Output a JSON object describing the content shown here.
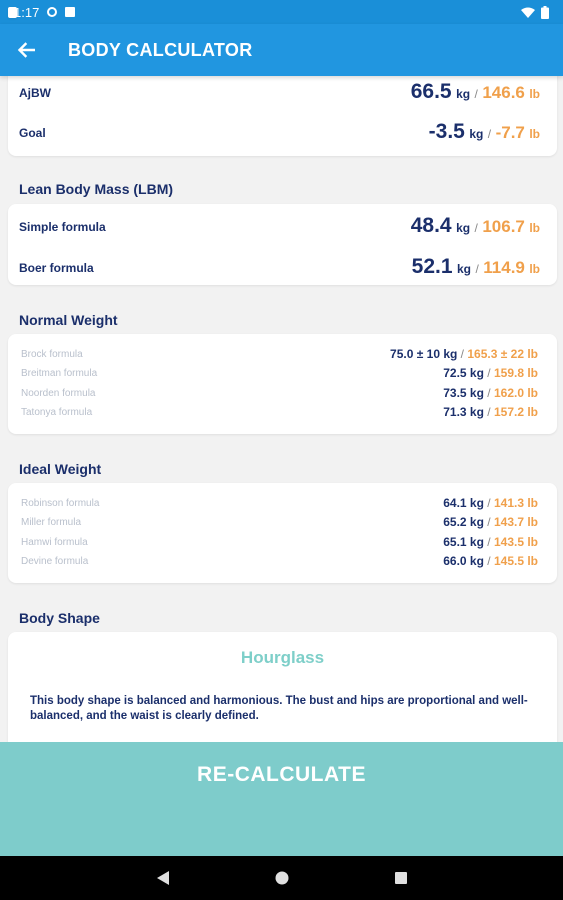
{
  "status": {
    "time": "1:17"
  },
  "app_bar": {
    "title": "BODY CALCULATOR"
  },
  "summary": {
    "rows": [
      {
        "label": "AjBW",
        "kg": "66.5",
        "kg_unit": "kg",
        "sep": "/",
        "lb": "146.6",
        "lb_unit": "lb"
      },
      {
        "label": "Goal",
        "kg": "-3.5",
        "kg_unit": "kg",
        "sep": "/",
        "lb": "-7.7",
        "lb_unit": "lb"
      }
    ]
  },
  "lbm": {
    "title": "Lean Body Mass (LBM)",
    "rows": [
      {
        "label": "Simple formula",
        "kg": "48.4",
        "kg_unit": "kg",
        "sep": "/",
        "lb": "106.7",
        "lb_unit": "lb"
      },
      {
        "label": "Boer formula",
        "kg": "52.1",
        "kg_unit": "kg",
        "sep": "/",
        "lb": "114.9",
        "lb_unit": "lb"
      }
    ]
  },
  "normal_weight": {
    "title": "Normal Weight",
    "rows": [
      {
        "label": "Brock formula",
        "kg": "75.0 ± 10 kg",
        "sep": "/",
        "lb": "165.3 ± 22 lb"
      },
      {
        "label": "Breitman formula",
        "kg": "72.5 kg",
        "sep": "/",
        "lb": "159.8 lb"
      },
      {
        "label": "Noorden formula",
        "kg": "73.5 kg",
        "sep": "/",
        "lb": "162.0 lb"
      },
      {
        "label": "Tatonya formula",
        "kg": "71.3 kg",
        "sep": "/",
        "lb": "157.2 lb"
      }
    ]
  },
  "ideal_weight": {
    "title": "Ideal Weight",
    "rows": [
      {
        "label": "Robinson formula",
        "kg": "64.1 kg",
        "sep": "/",
        "lb": "141.3 lb"
      },
      {
        "label": "Miller formula",
        "kg": "65.2 kg",
        "sep": "/",
        "lb": "143.7 lb"
      },
      {
        "label": "Hamwi formula",
        "kg": "65.1 kg",
        "sep": "/",
        "lb": "143.5 lb"
      },
      {
        "label": "Devine formula",
        "kg": "66.0 kg",
        "sep": "/",
        "lb": "145.5 lb"
      }
    ]
  },
  "body_shape": {
    "title": "Body Shape",
    "name": "Hourglass",
    "description": "This body shape is balanced and harmonious. The bust and hips are proportional and well-balanced, and the waist is clearly defined."
  },
  "recalculate": {
    "label": "RE-CALCULATE"
  },
  "icons": {
    "status": [
      "gear-icon",
      "notification-icon",
      "sd-card-icon",
      "wifi-icon",
      "battery-icon"
    ],
    "app_bar": "back-arrow-icon",
    "nav": [
      "nav-back-icon",
      "nav-home-icon",
      "nav-recents-icon"
    ]
  },
  "colors": {
    "status_bar": "#1a8fd8",
    "app_bar": "#2196e0",
    "navy_text": "#1b2f6b",
    "orange_text": "#f0a04b",
    "teal": "#7ecccb"
  }
}
